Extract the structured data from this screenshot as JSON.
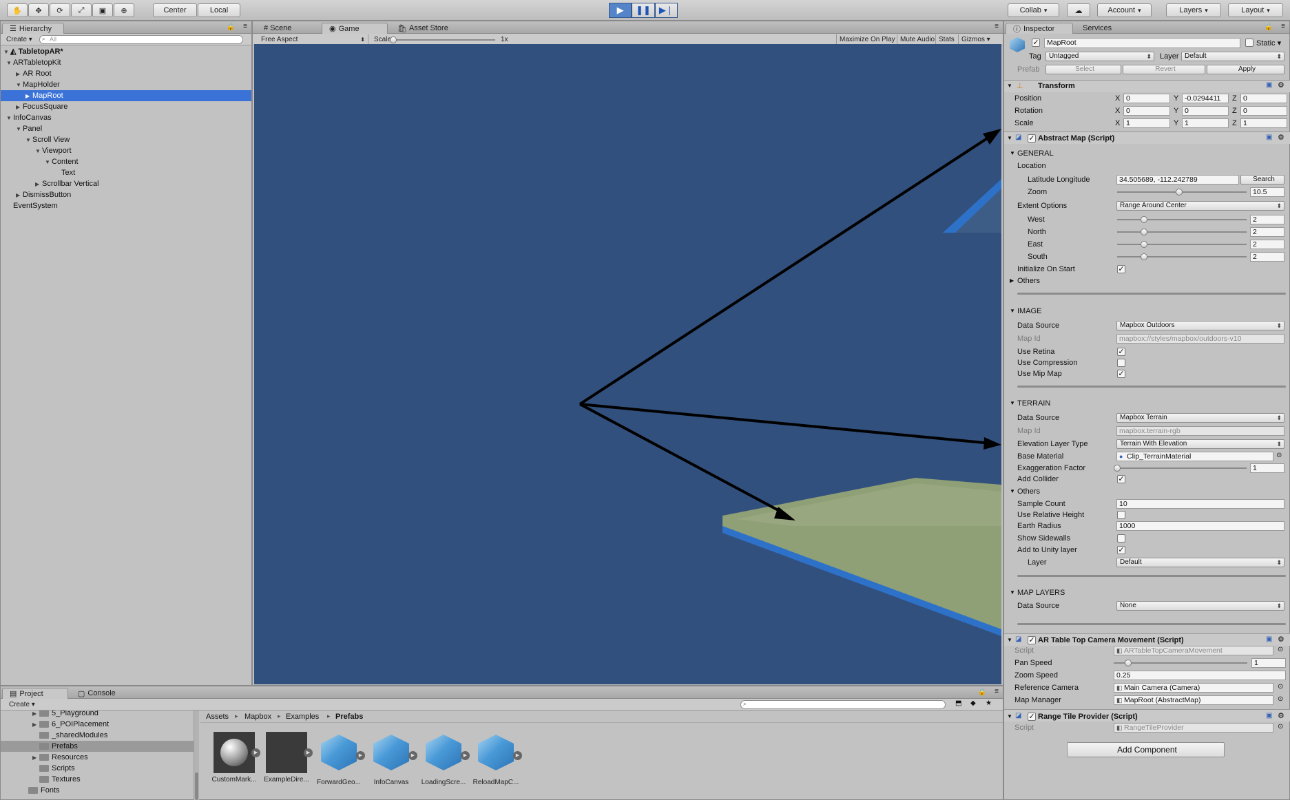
{
  "toolbar": {
    "tools": [
      "hand-tool-icon",
      "move-tool-icon",
      "rotate-tool-icon",
      "scale-tool-icon",
      "rect-tool-icon",
      "transform-tool-icon"
    ],
    "pivot": "Center",
    "space": "Local",
    "collab": "Collab",
    "account": "Account",
    "layers": "Layers",
    "layout": "Layout"
  },
  "hierarchy": {
    "tab": "Hierarchy",
    "create": "Create",
    "search_placeholder": "All",
    "scene": "TabletopAR*",
    "items": [
      {
        "label": "ARTabletopKit",
        "depth": 1,
        "expanded": true
      },
      {
        "label": "AR Root",
        "depth": 2,
        "expanded": false
      },
      {
        "label": "MapHolder",
        "depth": 2,
        "expanded": true
      },
      {
        "label": "MapRoot",
        "depth": 3,
        "expanded": false,
        "selected": true
      },
      {
        "label": "FocusSquare",
        "depth": 2,
        "expanded": false
      },
      {
        "label": "InfoCanvas",
        "depth": 1,
        "expanded": true
      },
      {
        "label": "Panel",
        "depth": 2,
        "expanded": true
      },
      {
        "label": "Scroll View",
        "depth": 3,
        "expanded": true
      },
      {
        "label": "Viewport",
        "depth": 4,
        "expanded": true
      },
      {
        "label": "Content",
        "depth": 5,
        "expanded": true
      },
      {
        "label": "Text",
        "depth": 6,
        "expanded": null
      },
      {
        "label": "Scrollbar Vertical",
        "depth": 4,
        "expanded": false
      },
      {
        "label": "DismissButton",
        "depth": 2,
        "expanded": false
      },
      {
        "label": "EventSystem",
        "depth": 1,
        "expanded": null
      }
    ]
  },
  "center_tabs": {
    "scene": "Scene",
    "game": "Game",
    "store": "Asset Store",
    "aspect": "Free Aspect",
    "scale_label": "Scale",
    "scale_value": "1x",
    "maximize": "Maximize On Play",
    "mute": "Mute Audio",
    "stats": "Stats",
    "gizmos": "Gizmos"
  },
  "inspector": {
    "tab": "Inspector",
    "services": "Services",
    "object_name": "MapRoot",
    "static": "Static",
    "tag_label": "Tag",
    "tag_value": "Untagged",
    "layer_label": "Layer",
    "layer_value": "Default",
    "prefab_label": "Prefab",
    "prefab_select": "Select",
    "prefab_revert": "Revert",
    "prefab_apply": "Apply",
    "transform": {
      "title": "Transform",
      "position": "Position",
      "pos": [
        "0",
        "-0.0294411",
        "0"
      ],
      "rotation": "Rotation",
      "rot": [
        "0",
        "0",
        "0"
      ],
      "scale": "Scale",
      "scl": [
        "1",
        "1",
        "1"
      ]
    },
    "abstract_map": {
      "title": "Abstract Map (Script)",
      "general": "GENERAL",
      "location": "Location",
      "latlon_label": "Latitude Longitude",
      "latlon_value": "34.505689, -112.242789",
      "search": "Search",
      "zoom_label": "Zoom",
      "zoom_value": "10.5",
      "zoom_level": 0.48,
      "extent_label": "Extent Options",
      "extent_value": "Range Around Center",
      "west": "West",
      "west_value": "2",
      "north": "North",
      "north_value": "2",
      "east": "East",
      "east_value": "2",
      "south": "South",
      "south_value": "2",
      "init_on_start": "Initialize On Start",
      "others": "Others",
      "image": "IMAGE",
      "img_source_label": "Data Source",
      "img_source_value": "Mapbox Outdoors",
      "img_mapid_label": "Map Id",
      "img_mapid_value": "mapbox://styles/mapbox/outdoors-v10",
      "use_retina": "Use Retina",
      "use_compression": "Use Compression",
      "use_mipmap": "Use Mip Map",
      "terrain": "TERRAIN",
      "ter_source_label": "Data Source",
      "ter_source_value": "Mapbox Terrain",
      "ter_mapid_label": "Map Id",
      "ter_mapid_value": "mapbox.terrain-rgb",
      "elev_label": "Elevation Layer Type",
      "elev_value": "Terrain With Elevation",
      "base_mat_label": "Base Material",
      "base_mat_value": "Clip_TerrainMaterial",
      "exag_label": "Exaggeration Factor",
      "exag_value": "1",
      "add_collider": "Add Collider",
      "others2": "Others",
      "sample_count_label": "Sample Count",
      "sample_count_value": "10",
      "use_rel_height": "Use Relative Height",
      "earth_radius_label": "Earth Radius",
      "earth_radius_value": "1000",
      "show_sidewalls": "Show Sidewalls",
      "add_unity_layer": "Add to Unity layer",
      "layer_label": "Layer",
      "layer_value": "Default",
      "map_layers": "MAP LAYERS",
      "ml_source_label": "Data Source",
      "ml_source_value": "None"
    },
    "camera_movement": {
      "title": "AR Table Top Camera Movement (Script)",
      "script_label": "Script",
      "script_value": "ARTableTopCameraMovement",
      "pan_label": "Pan Speed",
      "pan_value": "1",
      "zoom_label": "Zoom Speed",
      "zoom_value": "0.25",
      "ref_cam_label": "Reference Camera",
      "ref_cam_value": "Main Camera (Camera)",
      "map_mgr_label": "Map Manager",
      "map_mgr_value": "MapRoot (AbstractMap)"
    },
    "range_tile": {
      "title": "Range Tile Provider (Script)",
      "script_label": "Script",
      "script_value": "RangeTileProvider"
    },
    "add_component": "Add Component"
  },
  "project": {
    "tab": "Project",
    "console": "Console",
    "create": "Create",
    "folders": [
      {
        "label": "5_Playground",
        "depth": 2,
        "expanded": false
      },
      {
        "label": "6_POIPlacement",
        "depth": 2,
        "expanded": false
      },
      {
        "label": "_sharedModules",
        "depth": 2,
        "expanded": null
      },
      {
        "label": "Prefabs",
        "depth": 2,
        "expanded": null,
        "selected": true
      },
      {
        "label": "Resources",
        "depth": 2,
        "expanded": false
      },
      {
        "label": "Scripts",
        "depth": 2,
        "expanded": null
      },
      {
        "label": "Textures",
        "depth": 2,
        "expanded": null
      },
      {
        "label": "Fonts",
        "depth": 1,
        "expanded": null
      }
    ],
    "breadcrumb": [
      "Assets",
      "Mapbox",
      "Examples",
      "Prefabs"
    ],
    "assets": [
      {
        "label": "CustomMark...",
        "kind": "sphere"
      },
      {
        "label": "ExampleDire...",
        "kind": "dark"
      },
      {
        "label": "ForwardGeo...",
        "kind": "cube"
      },
      {
        "label": "InfoCanvas",
        "kind": "cube"
      },
      {
        "label": "LoadingScre...",
        "kind": "cube"
      },
      {
        "label": "ReloadMapC...",
        "kind": "cube"
      }
    ]
  },
  "colors": {
    "game_bg": "#32507d",
    "selection": "#3a72d8",
    "play_active": "#5684c8",
    "map_green": "#8f9f76",
    "map_edge": "#2d72c8"
  }
}
